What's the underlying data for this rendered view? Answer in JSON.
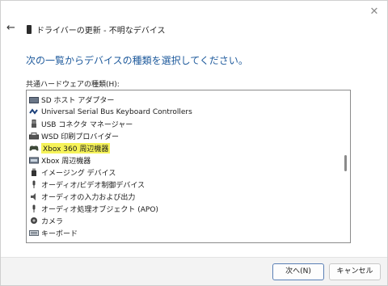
{
  "dialog": {
    "title": "ドライバーの更新 - 不明なデバイス",
    "instruction": "次の一覧からデバイスの種類を選択してください。",
    "list_label": "共通ハードウェアの種類(H):"
  },
  "hardware_types": [
    {
      "label": "SD ホスト アダプター",
      "icon": "sd-host-icon",
      "highlighted": false
    },
    {
      "label": "Universal Serial Bus Keyboard Controllers",
      "icon": "usb-keyboard-controller-icon",
      "highlighted": false
    },
    {
      "label": "USB コネクタ マネージャー",
      "icon": "usb-connector-icon",
      "highlighted": false
    },
    {
      "label": "WSD 印刷プロバイダー",
      "icon": "printer-icon",
      "highlighted": false
    },
    {
      "label": "Xbox 360 周辺機器",
      "icon": "xbox-controller-icon",
      "highlighted": true
    },
    {
      "label": "Xbox 周辺機器",
      "icon": "xbox-peripheral-icon",
      "highlighted": false
    },
    {
      "label": "イメージング デバイス",
      "icon": "imaging-device-icon",
      "highlighted": false
    },
    {
      "label": "オーディオ/ビデオ制御デバイス",
      "icon": "audio-video-icon",
      "highlighted": false
    },
    {
      "label": "オーディオの入力および出力",
      "icon": "audio-io-icon",
      "highlighted": false
    },
    {
      "label": "オーディオ処理オブジェクト (APO)",
      "icon": "audio-processing-icon",
      "highlighted": false
    },
    {
      "label": "カメラ",
      "icon": "camera-icon",
      "highlighted": false
    },
    {
      "label": "キーボード",
      "icon": "keyboard-icon",
      "highlighted": false
    }
  ],
  "buttons": {
    "next": "次へ(N)",
    "cancel": "キャンセル"
  },
  "colors": {
    "instruction": "#1e5a9c",
    "highlight": "#f6f35a"
  }
}
